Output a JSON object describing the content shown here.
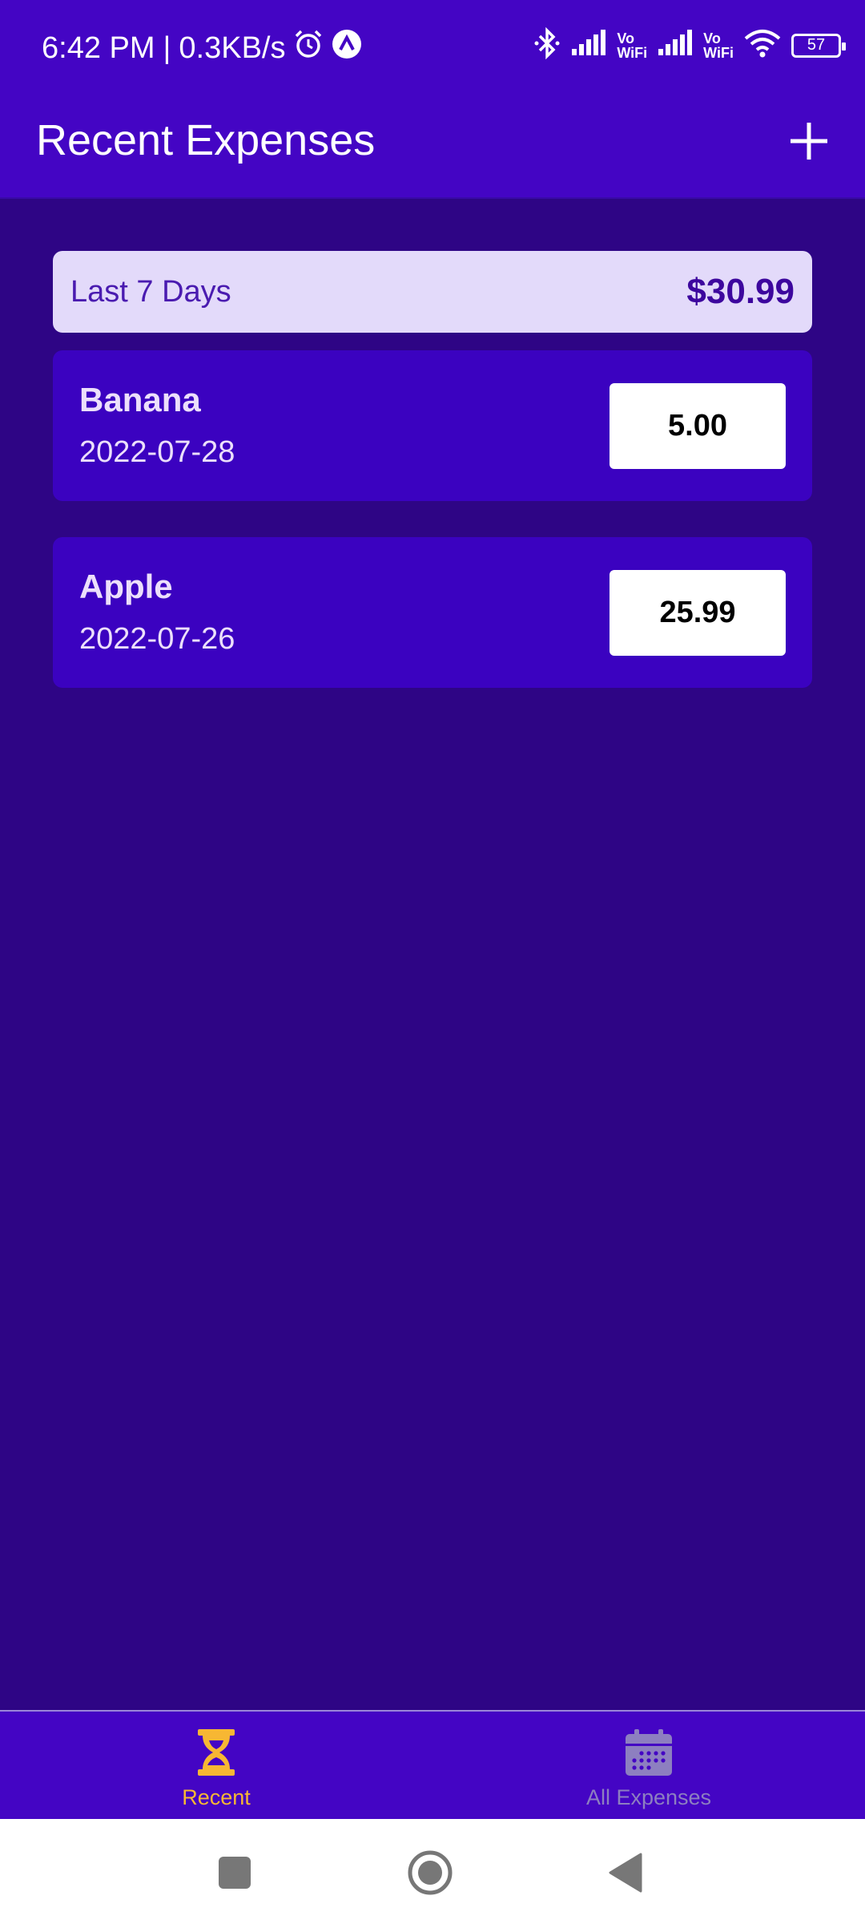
{
  "status_bar": {
    "time": "6:42 PM",
    "separator": "|",
    "net_speed": "0.3KB/s",
    "vowifi_1_line1": "Vo",
    "vowifi_1_line2": "WiFi",
    "vowifi_2_line1": "Vo",
    "vowifi_2_line2": "WiFi",
    "battery": "57",
    "icons": [
      "alarm-icon",
      "app-notification-icon",
      "bluetooth-icon",
      "signal-icon",
      "wifi-icon",
      "battery-icon"
    ]
  },
  "app_bar": {
    "title": "Recent Expenses",
    "add_icon": "plus-icon"
  },
  "summary": {
    "label": "Last 7 Days",
    "total": "$30.99"
  },
  "expenses": [
    {
      "name": "Banana",
      "date": "2022-07-28",
      "amount": "5.00"
    },
    {
      "name": "Apple",
      "date": "2022-07-26",
      "amount": "25.99"
    }
  ],
  "tabs": [
    {
      "label": "Recent",
      "icon": "hourglass-icon",
      "active": true
    },
    {
      "label": "All Expenses",
      "icon": "calendar-icon",
      "active": false
    }
  ],
  "colors": {
    "primary": "#4405c4",
    "background": "#2e0585",
    "card": "#3b02c0",
    "summary_bg": "#e3dafa",
    "active_tab": "#f7b733",
    "inactive_tab": "#8d7fc0"
  },
  "system_nav": [
    "recent-apps-button",
    "home-button",
    "back-button"
  ]
}
